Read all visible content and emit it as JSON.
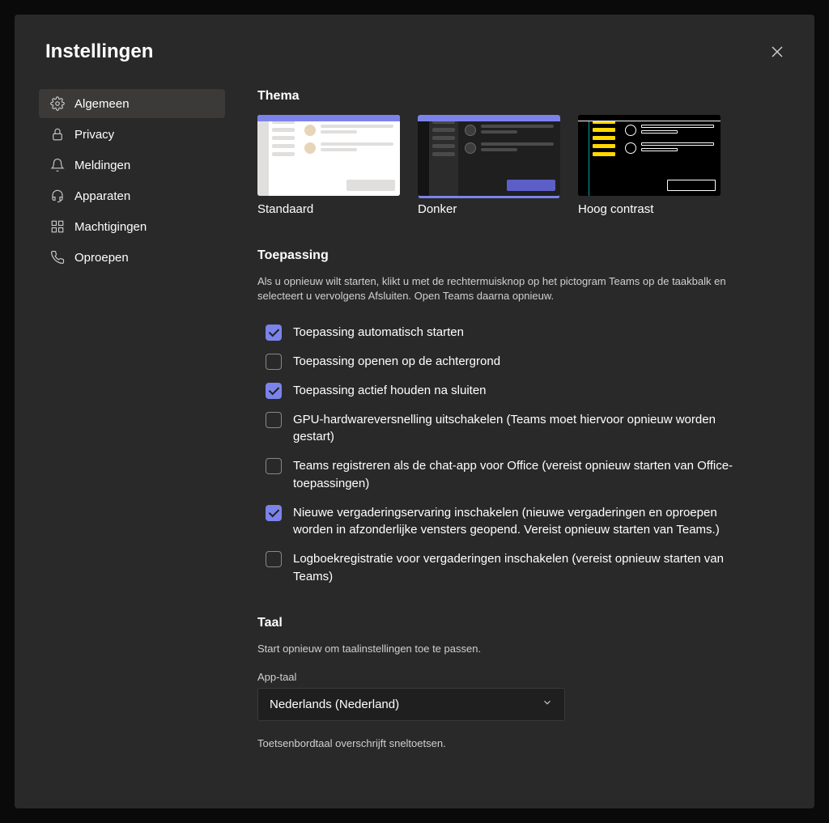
{
  "dialog": {
    "title": "Instellingen"
  },
  "sidebar": {
    "items": [
      {
        "label": "Algemeen",
        "icon": "gear"
      },
      {
        "label": "Privacy",
        "icon": "lock"
      },
      {
        "label": "Meldingen",
        "icon": "bell"
      },
      {
        "label": "Apparaten",
        "icon": "headset"
      },
      {
        "label": "Machtigingen",
        "icon": "grid"
      },
      {
        "label": "Oproepen",
        "icon": "phone"
      }
    ],
    "activeIndex": 0
  },
  "theme": {
    "title": "Thema",
    "options": [
      {
        "label": "Standaard"
      },
      {
        "label": "Donker"
      },
      {
        "label": "Hoog contrast"
      }
    ],
    "selectedIndex": 1
  },
  "application": {
    "title": "Toepassing",
    "desc": "Als u opnieuw wilt starten, klikt u met de rechtermuisknop op het pictogram Teams op de taakbalk en selecteert u vervolgens Afsluiten. Open Teams daarna opnieuw.",
    "checks": [
      {
        "label": "Toepassing automatisch starten",
        "checked": true
      },
      {
        "label": "Toepassing openen op de achtergrond",
        "checked": false
      },
      {
        "label": "Toepassing actief houden na sluiten",
        "checked": true
      },
      {
        "label": "GPU-hardwareversnelling uitschakelen (Teams moet hiervoor opnieuw worden gestart)",
        "checked": false
      },
      {
        "label": "Teams registreren als de chat-app voor Office (vereist opnieuw starten van Office-toepassingen)",
        "checked": false
      },
      {
        "label": "Nieuwe vergaderingservaring inschakelen (nieuwe vergaderingen en oproepen worden in afzonderlijke vensters geopend. Vereist opnieuw starten van Teams.)",
        "checked": true
      },
      {
        "label": "Logboekregistratie voor vergaderingen inschakelen (vereist opnieuw starten van Teams)",
        "checked": false
      }
    ]
  },
  "language": {
    "title": "Taal",
    "desc": "Start opnieuw om taalinstellingen toe te passen.",
    "field_label": "App-taal",
    "value": "Nederlands (Nederland)",
    "hint": "Toetsenbordtaal overschrijft sneltoetsen."
  }
}
